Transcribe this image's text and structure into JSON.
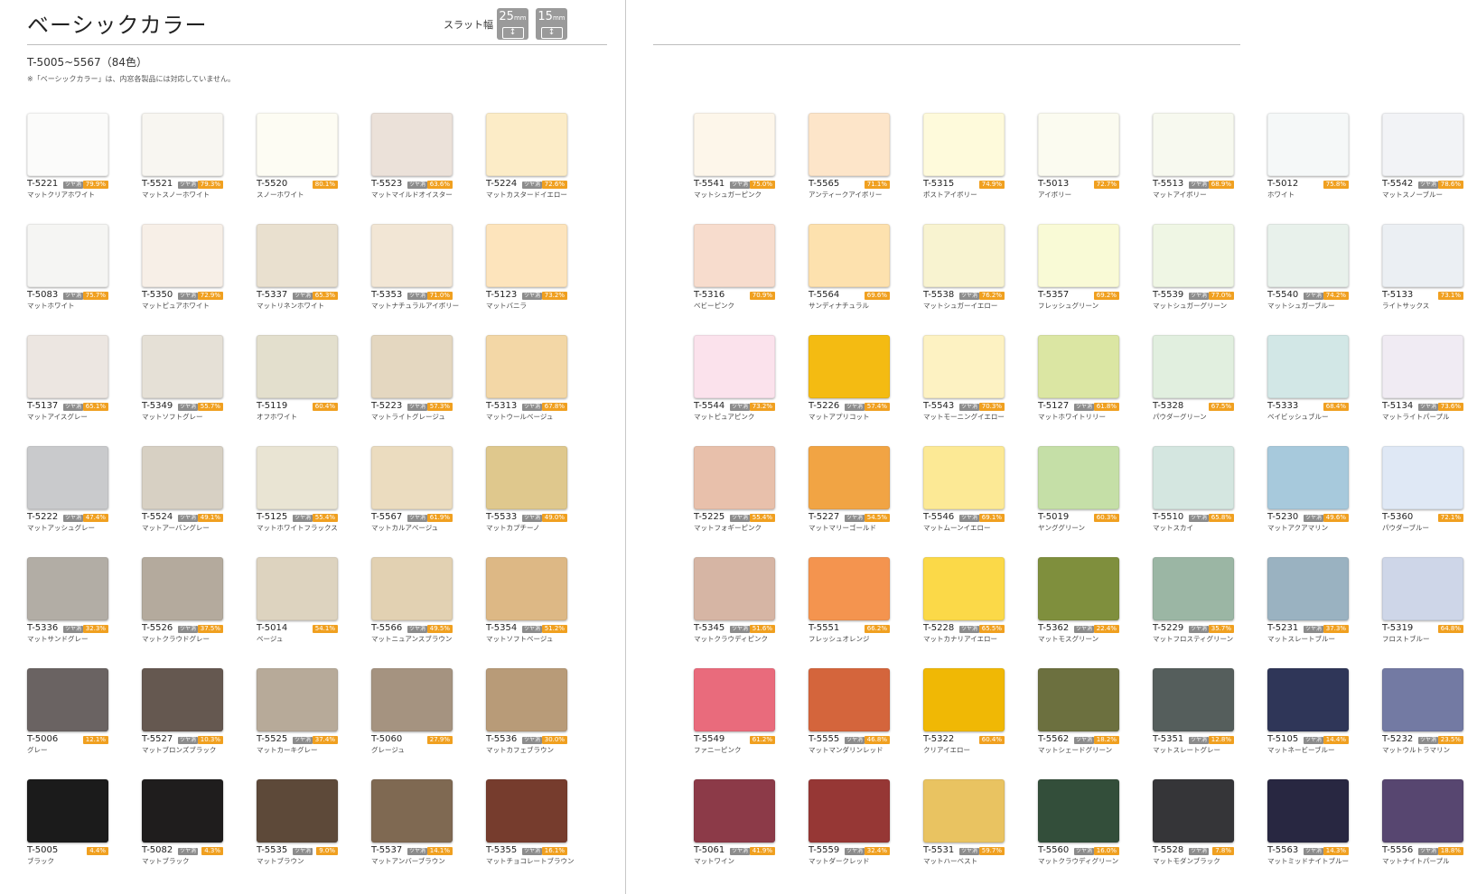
{
  "page": {
    "title": "ベーシックカラー",
    "slat_label": "スラット幅",
    "slat_badges": [
      {
        "num": "25",
        "unit": "mm",
        "icon": "↕"
      },
      {
        "num": "15",
        "unit": "mm",
        "icon": "↕"
      }
    ],
    "subtitle": "T-5005~5567（84色）",
    "note": "※「ベーシックカラー」は、内窓各製品には対応していません。"
  },
  "colors": {
    "accent_pct_badge": "#f0a020",
    "matte_tag": "#8c8c8c"
  },
  "left_columns": [
    [
      {
        "code": "T-5221",
        "matte": true,
        "pct": "79.9%",
        "name": "マットクリアホワイト",
        "color": "#fbfbfa"
      },
      {
        "code": "T-5083",
        "matte": true,
        "pct": "75.7%",
        "name": "マットホワイト",
        "color": "#f5f5f3"
      },
      {
        "code": "T-5137",
        "matte": true,
        "pct": "65.1%",
        "name": "マットアイスグレー",
        "color": "#ece6e1"
      },
      {
        "code": "T-5222",
        "matte": true,
        "pct": "47.4%",
        "name": "マットアッシュグレー",
        "color": "#c9cacc"
      },
      {
        "code": "T-5336",
        "matte": true,
        "pct": "32.3%",
        "name": "マットサンドグレー",
        "color": "#b2ada5"
      },
      {
        "code": "T-5006",
        "matte": false,
        "pct": "12.1%",
        "name": "グレー",
        "color": "#6a6362"
      },
      {
        "code": "T-5005",
        "matte": false,
        "pct": "4.4%",
        "name": "ブラック",
        "color": "#1b1b1b"
      }
    ],
    [
      {
        "code": "T-5521",
        "matte": true,
        "pct": "79.3%",
        "name": "マットスノーホワイト",
        "color": "#f8f6f1"
      },
      {
        "code": "T-5350",
        "matte": true,
        "pct": "72.9%",
        "name": "マットピュアホワイト",
        "color": "#f7efe7"
      },
      {
        "code": "T-5349",
        "matte": true,
        "pct": "55.7%",
        "name": "マットソフトグレー",
        "color": "#e5e0d6"
      },
      {
        "code": "T-5524",
        "matte": true,
        "pct": "49.1%",
        "name": "マットアーバングレー",
        "color": "#d7d0c3"
      },
      {
        "code": "T-5526",
        "matte": true,
        "pct": "37.5%",
        "name": "マットクラウドグレー",
        "color": "#b4aa9d"
      },
      {
        "code": "T-5527",
        "matte": true,
        "pct": "10.3%",
        "name": "マットブロンズブラック",
        "color": "#655850"
      },
      {
        "code": "T-5082",
        "matte": true,
        "pct": "4.3%",
        "name": "マットブラック",
        "color": "#1f1d1d"
      }
    ],
    [
      {
        "code": "T-5520",
        "matte": false,
        "pct": "80.1%",
        "name": "スノーホワイト",
        "color": "#fdfcf3"
      },
      {
        "code": "T-5337",
        "matte": true,
        "pct": "65.3%",
        "name": "マットリネンホワイト",
        "color": "#e9e0cf"
      },
      {
        "code": "T-5119",
        "matte": false,
        "pct": "60.4%",
        "name": "オフホワイト",
        "color": "#e3dfcd"
      },
      {
        "code": "T-5125",
        "matte": true,
        "pct": "55.4%",
        "name": "マットホワイトフラックス",
        "color": "#e9e4d3"
      },
      {
        "code": "T-5014",
        "matte": false,
        "pct": "54.1%",
        "name": "ベージュ",
        "color": "#ddd3bf"
      },
      {
        "code": "T-5525",
        "matte": true,
        "pct": "37.4%",
        "name": "マットカーキグレー",
        "color": "#b7aa99"
      },
      {
        "code": "T-5535",
        "matte": true,
        "pct": "9.0%",
        "name": "マットブラウン",
        "color": "#5d4939"
      }
    ],
    [
      {
        "code": "T-5523",
        "matte": true,
        "pct": "63.6%",
        "name": "マットマイルドオイスター",
        "color": "#ebe1d9"
      },
      {
        "code": "T-5353",
        "matte": true,
        "pct": "71.0%",
        "name": "マットナチュラルアイボリー",
        "color": "#f2e6d5"
      },
      {
        "code": "T-5223",
        "matte": true,
        "pct": "57.3%",
        "name": "マットライトグレージュ",
        "color": "#e4d7c0"
      },
      {
        "code": "T-5567",
        "matte": true,
        "pct": "61.9%",
        "name": "マットカルアベージュ",
        "color": "#ebdcbf"
      },
      {
        "code": "T-5566",
        "matte": true,
        "pct": "49.5%",
        "name": "マットニュアンスブラウン",
        "color": "#e2d1b2"
      },
      {
        "code": "T-5060",
        "matte": false,
        "pct": "27.9%",
        "name": "グレージュ",
        "color": "#a59380"
      },
      {
        "code": "T-5537",
        "matte": true,
        "pct": "14.1%",
        "name": "マットアンバーブラウン",
        "color": "#7f6952"
      }
    ],
    [
      {
        "code": "T-5224",
        "matte": true,
        "pct": "72.6%",
        "name": "マットカスタードイエロー",
        "color": "#fcecc7"
      },
      {
        "code": "T-5123",
        "matte": true,
        "pct": "73.2%",
        "name": "マットバニラ",
        "color": "#fde4bc"
      },
      {
        "code": "T-5313",
        "matte": true,
        "pct": "67.8%",
        "name": "マットウールベージュ",
        "color": "#f3d7a6"
      },
      {
        "code": "T-5533",
        "matte": true,
        "pct": "49.0%",
        "name": "マットカプチーノ",
        "color": "#dfc88d"
      },
      {
        "code": "T-5354",
        "matte": true,
        "pct": "51.2%",
        "name": "マットソフトベージュ",
        "color": "#ddb885"
      },
      {
        "code": "T-5536",
        "matte": true,
        "pct": "30.0%",
        "name": "マットカフェブラウン",
        "color": "#b89b78"
      },
      {
        "code": "T-5355",
        "matte": true,
        "pct": "16.1%",
        "name": "マットチョコレートブラウン",
        "color": "#763c2d"
      }
    ]
  ],
  "right_columns": [
    [
      {
        "code": "T-5541",
        "matte": true,
        "pct": "75.0%",
        "name": "マットシュガーピンク",
        "color": "#fdf6ea"
      },
      {
        "code": "T-5316",
        "matte": false,
        "pct": "70.9%",
        "name": "ベビーピンク",
        "color": "#f7dccd"
      },
      {
        "code": "T-5544",
        "matte": true,
        "pct": "73.2%",
        "name": "マットピュアピンク",
        "color": "#fbe2ec"
      },
      {
        "code": "T-5225",
        "matte": true,
        "pct": "55.4%",
        "name": "マットフォギーピンク",
        "color": "#e8c0ab"
      },
      {
        "code": "T-5345",
        "matte": true,
        "pct": "51.6%",
        "name": "マットクラウディピンク",
        "color": "#d6b5a4"
      },
      {
        "code": "T-5549",
        "matte": false,
        "pct": "61.2%",
        "name": "ファニーピンク",
        "color": "#e96b7c"
      },
      {
        "code": "T-5061",
        "matte": true,
        "pct": "41.9%",
        "name": "マットワイン",
        "color": "#8c3a48"
      }
    ],
    [
      {
        "code": "T-5565",
        "matte": false,
        "pct": "71.1%",
        "name": "アンティークアイボリー",
        "color": "#fde5c9"
      },
      {
        "code": "T-5564",
        "matte": false,
        "pct": "69.6%",
        "name": "サンディナチュラル",
        "color": "#fde1ae"
      },
      {
        "code": "T-5226",
        "matte": true,
        "pct": "57.4%",
        "name": "マットアプリコット",
        "color": "#f4bb12"
      },
      {
        "code": "T-5227",
        "matte": true,
        "pct": "54.5%",
        "name": "マットマリーゴールド",
        "color": "#f1a444"
      },
      {
        "code": "T-5551",
        "matte": false,
        "pct": "66.2%",
        "name": "フレッシュオレンジ",
        "color": "#f4944f"
      },
      {
        "code": "T-5555",
        "matte": true,
        "pct": "46.8%",
        "name": "マットマンダリンレッド",
        "color": "#d4653c"
      },
      {
        "code": "T-5559",
        "matte": true,
        "pct": "32.4%",
        "name": "マットダークレッド",
        "color": "#963735"
      }
    ],
    [
      {
        "code": "T-5315",
        "matte": false,
        "pct": "74.9%",
        "name": "ポストアイボリー",
        "color": "#fefadb"
      },
      {
        "code": "T-5538",
        "matte": true,
        "pct": "76.2%",
        "name": "マットシュガーイエロー",
        "color": "#f8f3d0"
      },
      {
        "code": "T-5543",
        "matte": true,
        "pct": "70.3%",
        "name": "マットモーニングイエロー",
        "color": "#fdf2c2"
      },
      {
        "code": "T-5546",
        "matte": true,
        "pct": "69.1%",
        "name": "マットムーンイエロー",
        "color": "#fce995"
      },
      {
        "code": "T-5228",
        "matte": true,
        "pct": "65.5%",
        "name": "マットカナリアイエロー",
        "color": "#fbd948"
      },
      {
        "code": "T-5322",
        "matte": false,
        "pct": "60.4%",
        "name": "クリアイエロー",
        "color": "#f0b805"
      },
      {
        "code": "T-5531",
        "matte": true,
        "pct": "59.7%",
        "name": "マットハーベスト",
        "color": "#e9c361"
      }
    ],
    [
      {
        "code": "T-5013",
        "matte": false,
        "pct": "72.7%",
        "name": "アイボリー",
        "color": "#fbfbf0"
      },
      {
        "code": "T-5357",
        "matte": false,
        "pct": "69.2%",
        "name": "フレッシュグリーン",
        "color": "#f9fad6"
      },
      {
        "code": "T-5127",
        "matte": true,
        "pct": "61.8%",
        "name": "マットホワイトリリー",
        "color": "#dbe6a3"
      },
      {
        "code": "T-5019",
        "matte": false,
        "pct": "60.3%",
        "name": "ヤンググリーン",
        "color": "#c5dfa7"
      },
      {
        "code": "T-5362",
        "matte": true,
        "pct": "22.4%",
        "name": "マットモスグリーン",
        "color": "#7f8f3d"
      },
      {
        "code": "T-5562",
        "matte": true,
        "pct": "18.2%",
        "name": "マットシェードグリーン",
        "color": "#6c703f"
      },
      {
        "code": "T-5560",
        "matte": true,
        "pct": "16.0%",
        "name": "マットクラウディグリーン",
        "color": "#334e3a"
      }
    ],
    [
      {
        "code": "T-5513",
        "matte": true,
        "pct": "68.9%",
        "name": "マットアイボリー",
        "color": "#f7f9ef"
      },
      {
        "code": "T-5539",
        "matte": true,
        "pct": "77.0%",
        "name": "マットシュガーグリーン",
        "color": "#eff6e4"
      },
      {
        "code": "T-5328",
        "matte": false,
        "pct": "67.5%",
        "name": "パウダーグリーン",
        "color": "#e1efdf"
      },
      {
        "code": "T-5510",
        "matte": true,
        "pct": "65.8%",
        "name": "マットスカイ",
        "color": "#d4e6e0"
      },
      {
        "code": "T-5229",
        "matte": true,
        "pct": "35.7%",
        "name": "マットフロスティグリーン",
        "color": "#9bb6a4"
      },
      {
        "code": "T-5351",
        "matte": true,
        "pct": "12.8%",
        "name": "マットスレートグレー",
        "color": "#555e5c"
      },
      {
        "code": "T-5528",
        "matte": true,
        "pct": "7.8%",
        "name": "マットモダンブラック",
        "color": "#353538"
      }
    ],
    [
      {
        "code": "T-5012",
        "matte": false,
        "pct": "75.8%",
        "name": "ホワイト",
        "color": "#f5f8f8"
      },
      {
        "code": "T-5540",
        "matte": true,
        "pct": "74.2%",
        "name": "マットシュガーブルー",
        "color": "#e8f1eb"
      },
      {
        "code": "T-5333",
        "matte": false,
        "pct": "68.4%",
        "name": "ベイビッシュブルー",
        "color": "#d2e7e6"
      },
      {
        "code": "T-5230",
        "matte": true,
        "pct": "49.6%",
        "name": "マットアクアマリン",
        "color": "#a7c9dc"
      },
      {
        "code": "T-5231",
        "matte": true,
        "pct": "37.3%",
        "name": "マットスレートブルー",
        "color": "#9ab2c1"
      },
      {
        "code": "T-5105",
        "matte": true,
        "pct": "14.4%",
        "name": "マットネービーブルー",
        "color": "#2f3658"
      },
      {
        "code": "T-5563",
        "matte": true,
        "pct": "14.3%",
        "name": "マットミッドナイトブルー",
        "color": "#282741"
      }
    ],
    [
      {
        "code": "T-5542",
        "matte": true,
        "pct": "78.6%",
        "name": "マットスノーブルー",
        "color": "#f2f3f6"
      },
      {
        "code": "T-5133",
        "matte": false,
        "pct": "73.1%",
        "name": "ライトサックス",
        "color": "#ebeff3"
      },
      {
        "code": "T-5134",
        "matte": true,
        "pct": "73.6%",
        "name": "マットライトパープル",
        "color": "#f0ebf3"
      },
      {
        "code": "T-5360",
        "matte": false,
        "pct": "72.1%",
        "name": "パウダーブルー",
        "color": "#dfe8f5"
      },
      {
        "code": "T-5319",
        "matte": false,
        "pct": "64.8%",
        "name": "フロストブルー",
        "color": "#ced6e8"
      },
      {
        "code": "T-5232",
        "matte": true,
        "pct": "23.5%",
        "name": "マットウルトラマリン",
        "color": "#737aa3"
      },
      {
        "code": "T-5556",
        "matte": true,
        "pct": "18.8%",
        "name": "マットナイトパープル",
        "color": "#574670"
      }
    ]
  ],
  "matte_tag_label": "ツヤ消"
}
